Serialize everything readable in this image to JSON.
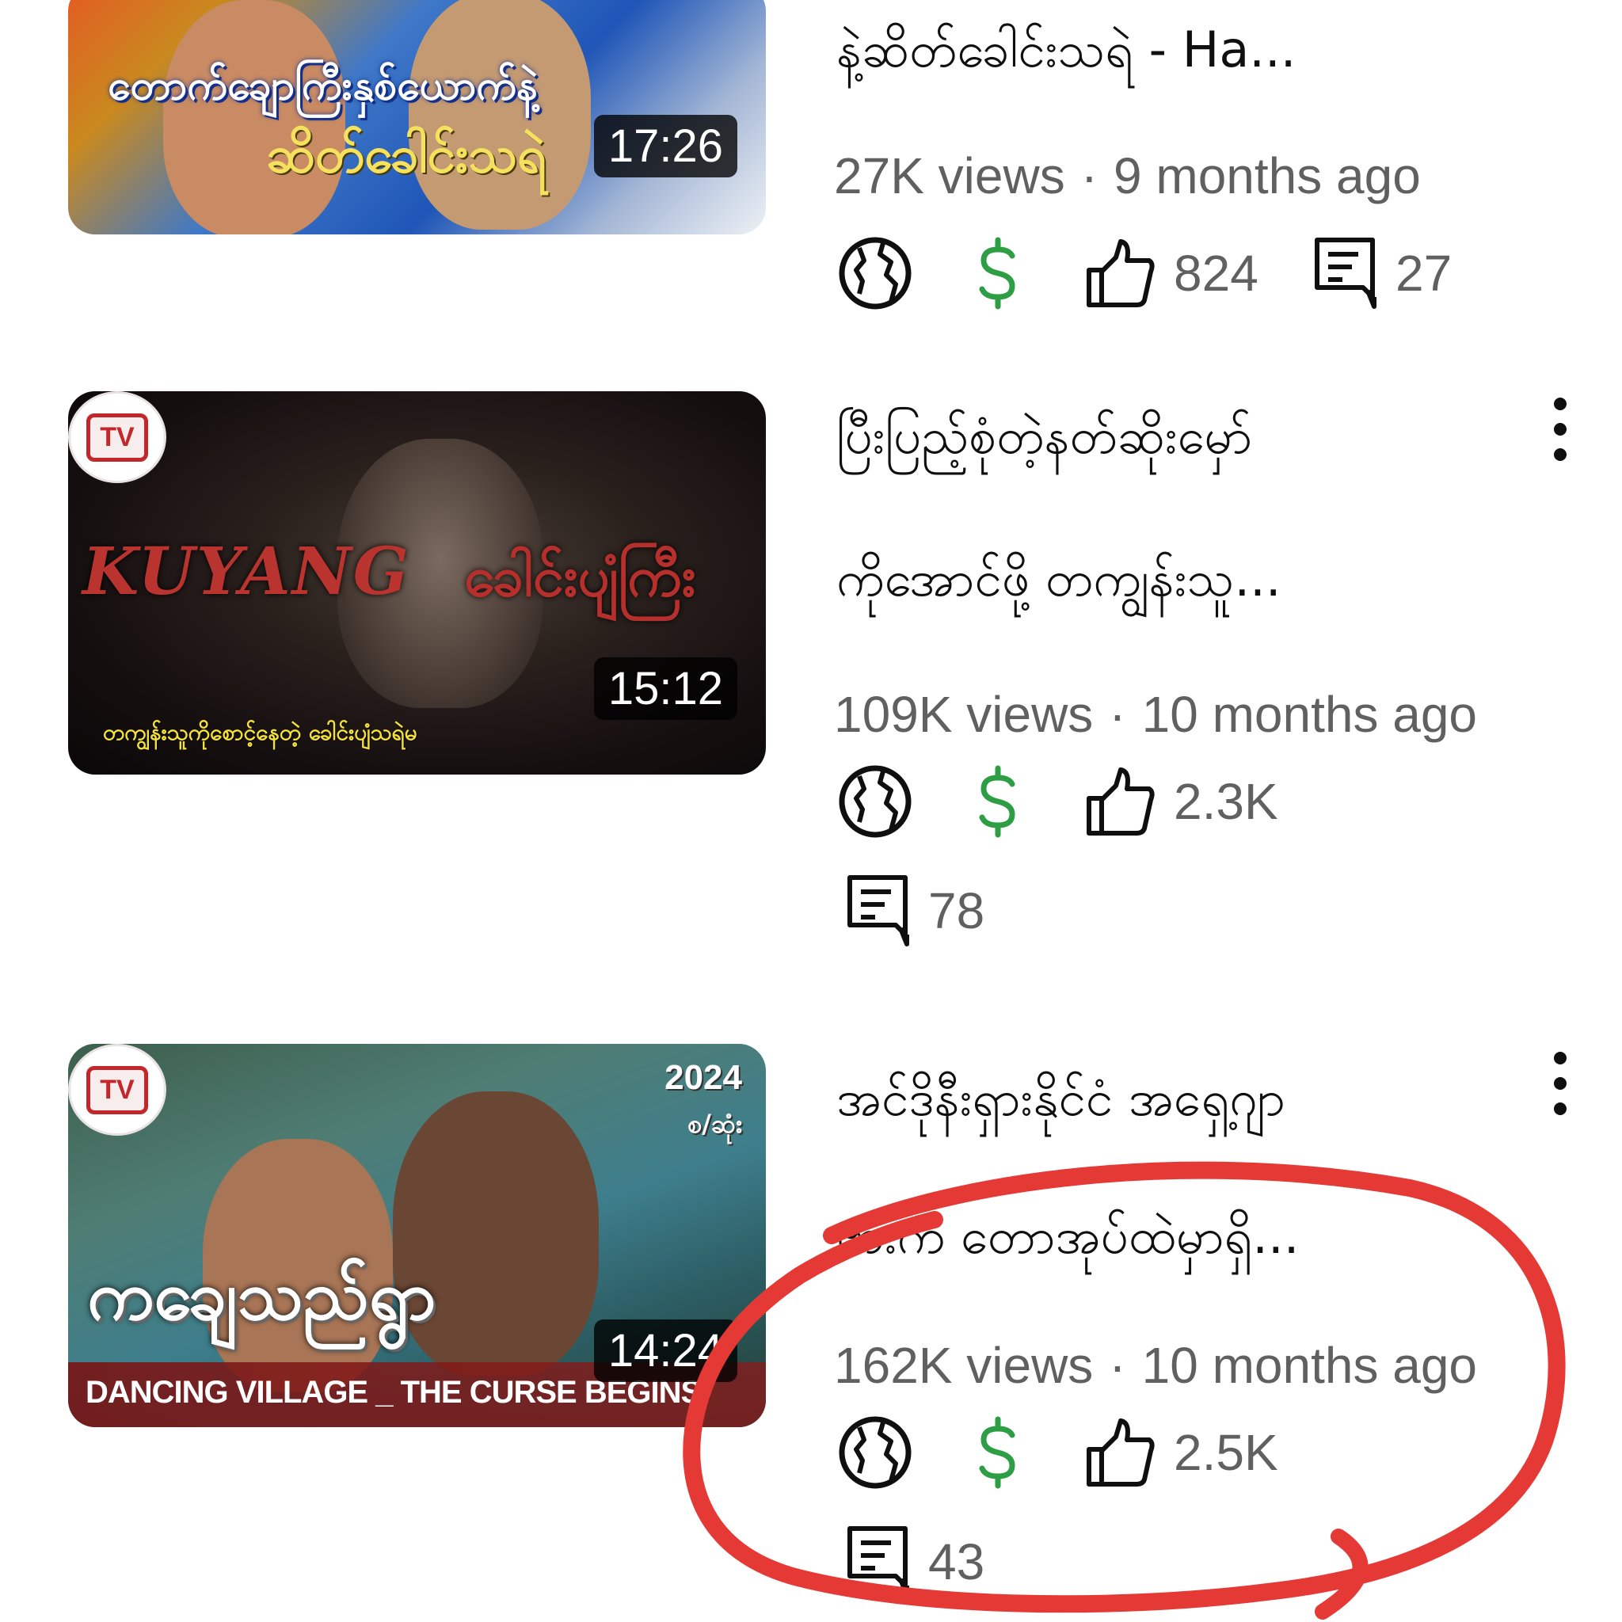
{
  "videos": [
    {
      "thumbnail_caption_1": "တောက်ချောကြီးနှစ်ယောက်နဲ့",
      "thumbnail_caption_2": "ဆိတ်ခေါင်းသရဲ",
      "duration": "17:26",
      "title_line_1": "နဲ့ဆိတ်ခေါင်းသရဲ - Ha...",
      "views": "27K views",
      "age": "9 months ago",
      "likes": "824",
      "comments": "27"
    },
    {
      "thumbnail_logo": "TV",
      "thumbnail_text_left": "KUYANG",
      "thumbnail_text_right": "ခေါင်းပျံကြီး",
      "thumbnail_caption": "တကျွန်းသူကိုစောင့်နေတဲ့ ခေါင်းပျံသရဲမ",
      "duration": "15:12",
      "title_line_1": "ပြီးပြည့်စုံတဲ့နတ်ဆိုးမှော်",
      "title_line_2": "ကိုအောင်ဖို့ တကျွန်းသူ...",
      "views": "109K views",
      "age": "10 months ago",
      "likes": "2.3K",
      "comments": "78"
    },
    {
      "thumbnail_logo": "TV",
      "thumbnail_year": "2024",
      "thumbnail_sub": "စ/ဆုံး",
      "thumbnail_title": "ကချေသည်ရွာ",
      "thumbnail_caption": "DANCING VILLAGE _ THE CURSE BEGINS",
      "duration": "14:24",
      "title_line_1": "အင်ဒိုနီးရှားနိုင်ငံ အရှေ့ဂျာ",
      "title_line_2": "ဗားက တောအုပ်ထဲမှာရှိ...",
      "views": "162K views",
      "age": "10 months ago",
      "likes": "2.5K",
      "comments": "43"
    }
  ],
  "meta_separator": "·",
  "colors": {
    "monetization_green": "#2e9e44",
    "annotation_red": "#e53935",
    "meta_gray": "#606060"
  },
  "icons": [
    "globe-icon",
    "dollar-icon",
    "thumbs-up-icon",
    "comment-icon",
    "more-vert-icon"
  ]
}
